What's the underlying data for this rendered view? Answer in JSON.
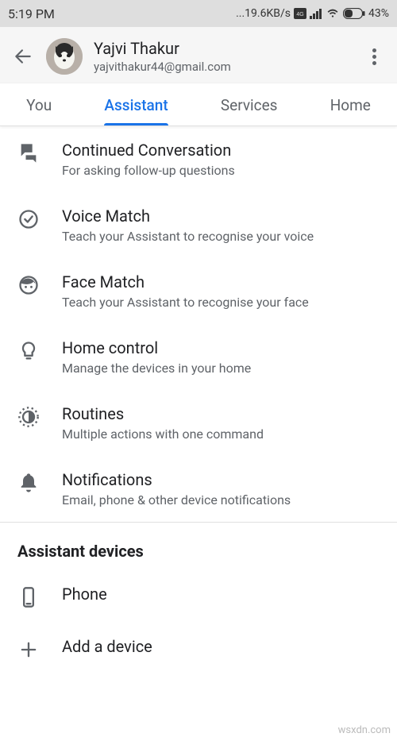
{
  "statusbar": {
    "time": "5:19 PM",
    "speed": "...19.6KB/s",
    "battery": "43%"
  },
  "header": {
    "user_name": "Yajvi Thakur",
    "user_email": "yajvithakur44@gmail.com"
  },
  "tabs": [
    {
      "label": "You",
      "active": false
    },
    {
      "label": "Assistant",
      "active": true
    },
    {
      "label": "Services",
      "active": false
    },
    {
      "label": "Home",
      "active": false
    }
  ],
  "settings": [
    {
      "icon": "chat-icon",
      "title": "Continued Conversation",
      "sub": "For asking follow-up questions"
    },
    {
      "icon": "check-circle-icon",
      "title": "Voice Match",
      "sub": "Teach your Assistant to recognise your voice"
    },
    {
      "icon": "face-icon",
      "title": "Face Match",
      "sub": "Teach your Assistant to recognise your face"
    },
    {
      "icon": "bulb-icon",
      "title": "Home control",
      "sub": "Manage the devices in your home"
    },
    {
      "icon": "routines-icon",
      "title": "Routines",
      "sub": "Multiple actions with one command"
    },
    {
      "icon": "bell-icon",
      "title": "Notifications",
      "sub": "Email, phone & other device notifications"
    }
  ],
  "devices_section": {
    "header": "Assistant devices",
    "items": [
      {
        "icon": "phone-icon",
        "title": "Phone"
      },
      {
        "icon": "plus-icon",
        "title": "Add a device"
      }
    ]
  },
  "watermark": "wsxdn.com"
}
